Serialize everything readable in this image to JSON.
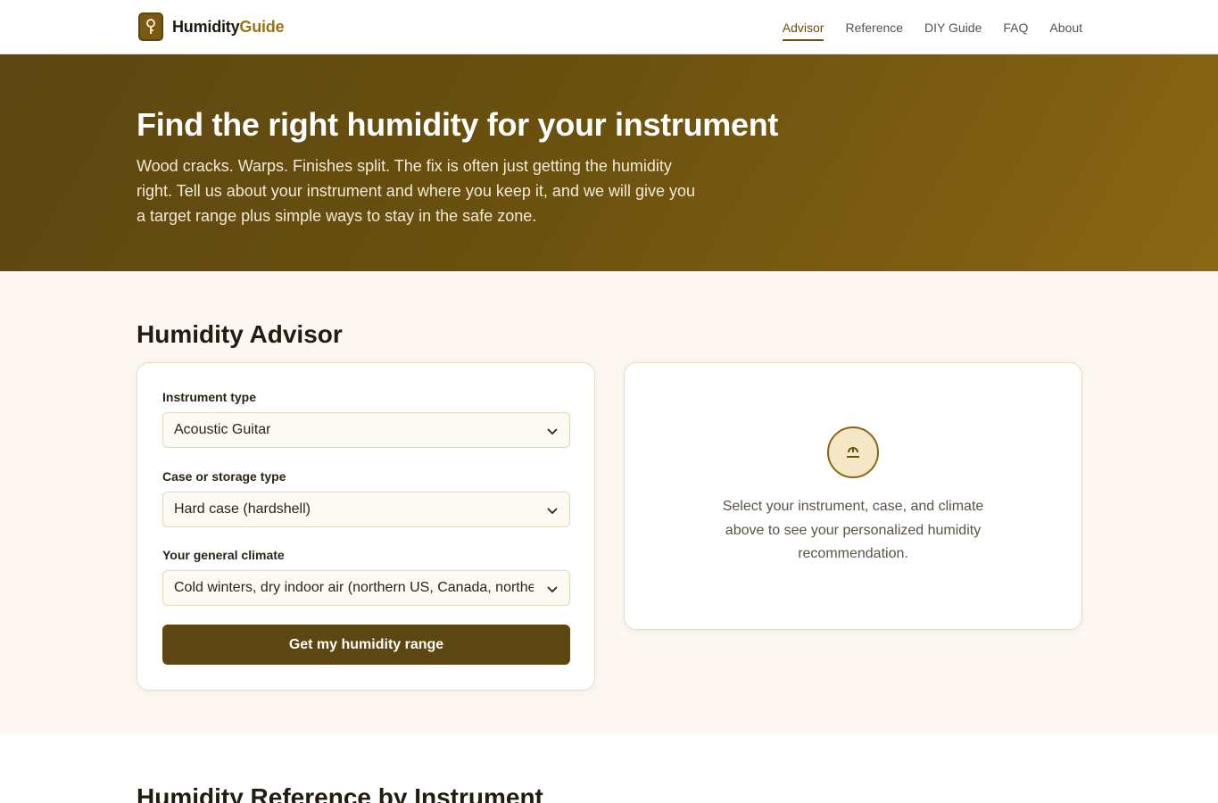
{
  "brand": {
    "name_main": "Humidity",
    "name_accent": "Guide",
    "logo_icon": "thermometer-key-icon"
  },
  "nav": {
    "items": [
      {
        "label": "Advisor",
        "active": true
      },
      {
        "label": "Reference",
        "active": false
      },
      {
        "label": "DIY Guide",
        "active": false
      },
      {
        "label": "FAQ",
        "active": false
      },
      {
        "label": "About",
        "active": false
      }
    ]
  },
  "hero": {
    "title": "Find the right humidity for your instrument",
    "subtitle": "Wood cracks. Warps. Finishes split. The fix is often just getting the humidity right. Tell us about your instrument and where you keep it, and we will give you a target range plus simple ways to stay in the safe zone."
  },
  "advisor": {
    "heading": "Humidity Advisor",
    "fields": [
      {
        "label": "Instrument type",
        "value": "Acoustic Guitar"
      },
      {
        "label": "Case or storage type",
        "value": "Hard case (hardshell)"
      },
      {
        "label": "Your general climate",
        "value": "Cold winters, dry indoor air (northern US, Canada, northe"
      }
    ],
    "submit_label": "Get my humidity range",
    "result_icon": "gauge-icon",
    "result_placeholder": "Select your instrument, case, and climate above to see your personalized humidity recommendation."
  },
  "reference": {
    "heading": "Humidity Reference by Instrument"
  },
  "colors": {
    "accent": "#5c4611",
    "accent_light": "#9a7412",
    "hero_start": "#5c4611",
    "hero_end": "#8a6614",
    "section_bg": "#fcf8f1"
  }
}
